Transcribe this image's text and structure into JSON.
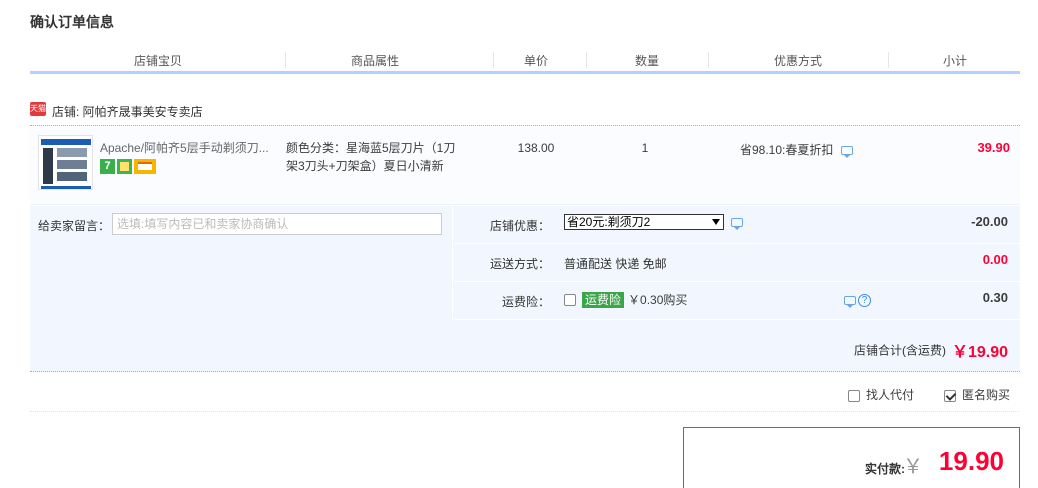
{
  "page": {
    "title": "确认订单信息"
  },
  "columns": [
    "店铺宝贝",
    "商品属性",
    "单价",
    "数量",
    "优惠方式",
    "小计"
  ],
  "shop": {
    "tag": "天猫",
    "label": "店铺: 阿帕齐晟事美安专卖店"
  },
  "item": {
    "name": "Apache/阿帕齐5层手动剃须刀...",
    "badges": {
      "seven_day": "7"
    },
    "attribute": "颜色分类：星海蓝5层刀片（1刀架3刀头+刀架盒）夏日小清新",
    "price": "138.00",
    "quantity": "1",
    "discount": "省98.10:春夏折扣",
    "subtotal": "39.90"
  },
  "message": {
    "label": "给卖家留言：",
    "placeholder": "选填:填写内容已和卖家协商确认"
  },
  "coupon": {
    "label": "店铺优惠：",
    "selected": "省20元:剃须刀2",
    "amount": "-20.00"
  },
  "shipping": {
    "label": "运送方式：",
    "value": "普通配送 快递 免邮",
    "amount": "0.00"
  },
  "insurance": {
    "label": "运费险：",
    "tag": "运费险",
    "text": "￥0.30购买",
    "amount": "0.30",
    "help": "?"
  },
  "shop_total": {
    "label": "店铺合计(含运费)",
    "value": "￥19.90"
  },
  "extras": {
    "proxy_pay": "找人代付",
    "anonymous": "匿名购买"
  },
  "payment": {
    "label": "实付款:",
    "yen": "￥",
    "value": "19.90"
  },
  "colors": {
    "accent_red": "#ff0036",
    "header_line": "#b2d1ff",
    "panel_bg": "#f2f7ff",
    "insurance_green": "#3ba54a"
  }
}
